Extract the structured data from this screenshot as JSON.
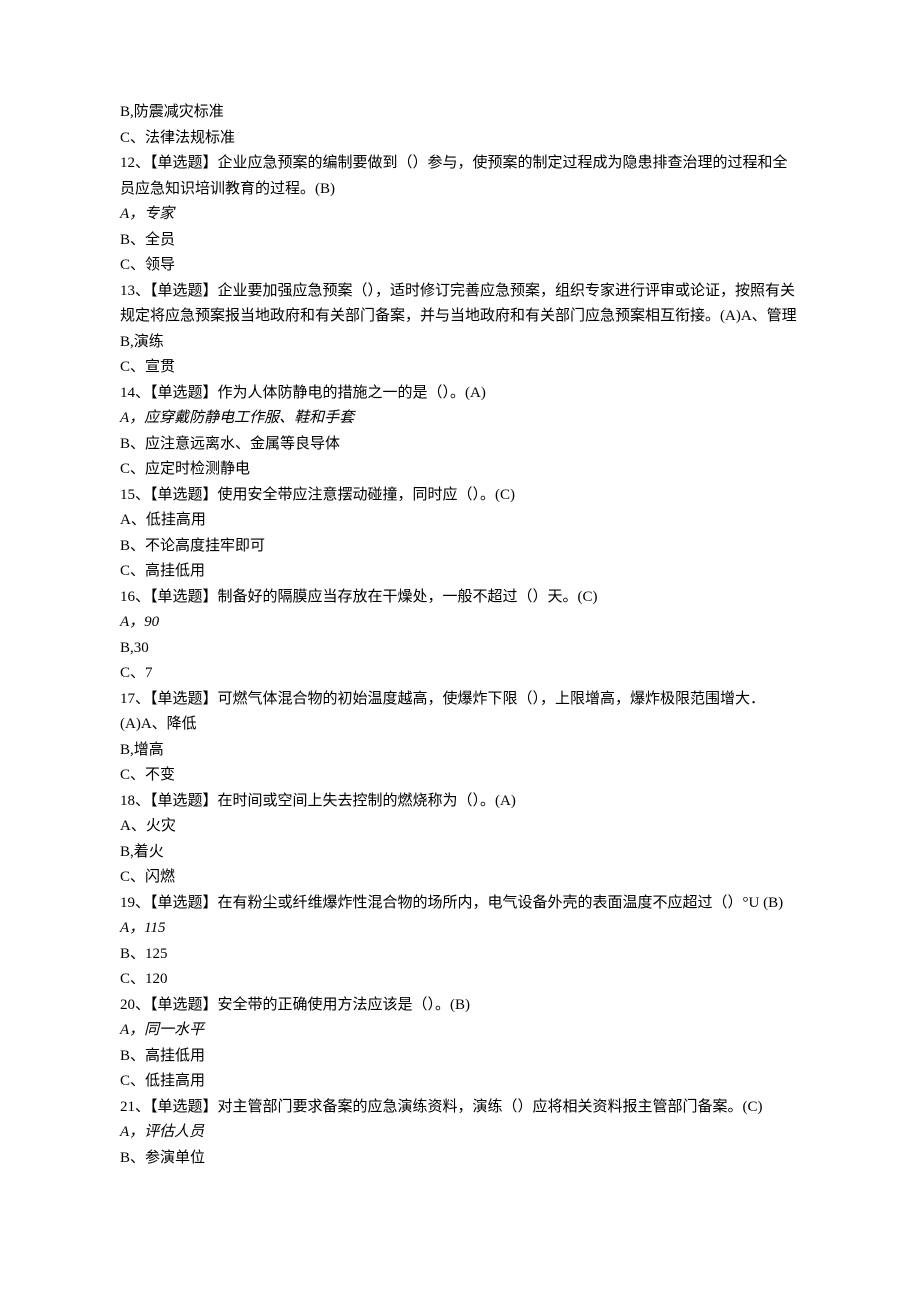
{
  "lines": [
    {
      "text": "B,防震减灾标准",
      "italic": false
    },
    {
      "text": "C、法律法规标准",
      "italic": false
    },
    {
      "text": "12、【单选题】企业应急预案的编制要做到（）参与，使预案的制定过程成为隐患排查治理的过程和全员应急知识培训教育的过程。(B)",
      "italic": false
    },
    {
      "text": "A，专家",
      "italic": true
    },
    {
      "text": "B、全员",
      "italic": false
    },
    {
      "text": "C、领导",
      "italic": false
    },
    {
      "text": "13、【单选题】企业要加强应急预案（），适时修订完善应急预案，组织专家进行评审或论证，按照有关规定将应急预案报当地政府和有关部门备案，并与当地政府和有关部门应急预案相互衔接。(A)A、管理",
      "italic": false
    },
    {
      "text": "B,演练",
      "italic": false
    },
    {
      "text": "C、宣贯",
      "italic": false
    },
    {
      "text": "14、【单选题】作为人体防静电的措施之一的是（）。(A)",
      "italic": false
    },
    {
      "text": "A，应穿戴防静电工作服、鞋和手套",
      "italic": true
    },
    {
      "text": "B、应注意远离水、金属等良导体",
      "italic": false
    },
    {
      "text": "C、应定时检测静电",
      "italic": false
    },
    {
      "text": "15、【单选题】使用安全带应注意摆动碰撞，同时应（）。(C)",
      "italic": false
    },
    {
      "text": "A、低挂高用",
      "italic": false
    },
    {
      "text": "B、不论高度挂牢即可",
      "italic": false
    },
    {
      "text": "C、高挂低用",
      "italic": false
    },
    {
      "text": "16、【单选题】制备好的隔膜应当存放在干燥处，一般不超过（）天。(C)",
      "italic": false
    },
    {
      "text": "A，90",
      "italic": true
    },
    {
      "text": "B,30",
      "italic": false
    },
    {
      "text": "C、7",
      "italic": false
    },
    {
      "text": "17、【单选题】可燃气体混合物的初始温度越高，使爆炸下限（），上限增高，爆炸极限范围增大．(A)A、降低",
      "italic": false
    },
    {
      "text": "B,增高",
      "italic": false
    },
    {
      "text": "C、不变",
      "italic": false
    },
    {
      "text": "18、【单选题】在时间或空间上失去控制的燃烧称为（）。(A)",
      "italic": false
    },
    {
      "text": "A、火灾",
      "italic": false
    },
    {
      "text": "B,着火",
      "italic": false
    },
    {
      "text": "C、闪燃",
      "italic": false
    },
    {
      "text": "19、【单选题】在有粉尘或纤维爆炸性混合物的场所内，电气设备外壳的表面温度不应超过（）°U (B)",
      "italic": false
    },
    {
      "text": "A，115",
      "italic": true
    },
    {
      "text": "B、125",
      "italic": false
    },
    {
      "text": "C、120",
      "italic": false
    },
    {
      "text": "20、【单选题】安全带的正确使用方法应该是（）。(B)",
      "italic": false
    },
    {
      "text": "A，同一水平",
      "italic": true
    },
    {
      "text": "B、高挂低用",
      "italic": false
    },
    {
      "text": "C、低挂高用",
      "italic": false
    },
    {
      "text": "21、【单选题】对主管部门要求备案的应急演练资料，演练（）应将相关资料报主管部门备案。(C)",
      "italic": false
    },
    {
      "text": "A，评估人员",
      "italic": true
    },
    {
      "text": "B、参演单位",
      "italic": false
    }
  ]
}
